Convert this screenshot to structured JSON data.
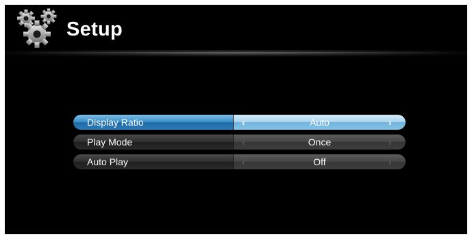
{
  "header": {
    "title": "Setup",
    "icon": "gears-icon"
  },
  "menu": {
    "selected_index": 0,
    "items": [
      {
        "label": "Display Ratio",
        "value": "Auto"
      },
      {
        "label": "Play Mode",
        "value": "Once"
      },
      {
        "label": "Auto Play",
        "value": "Off"
      }
    ]
  },
  "colors": {
    "background": "#000000",
    "selected_accent": "#3a8fc8",
    "text": "#ffffff"
  }
}
